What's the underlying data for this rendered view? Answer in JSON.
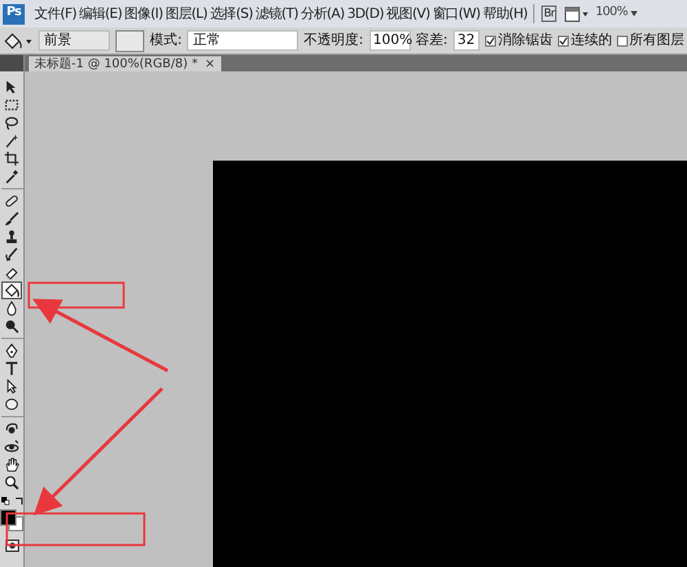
{
  "menu_bar": {
    "app_icon": "Ps",
    "items": [
      "文件(F)",
      "编辑(E)",
      "图像(I)",
      "图层(L)",
      "选择(S)",
      "滤镜(T)",
      "分析(A)",
      "3D(D)",
      "视图(V)",
      "窗口(W)",
      "帮助(H)"
    ],
    "bridge_button": "Br",
    "zoom": "100%"
  },
  "options_bar": {
    "fill_source": "前景",
    "mode_label": "模式:",
    "mode": "正常",
    "opacity_label": "不透明度:",
    "opacity": "100%",
    "tolerance_label": "容差:",
    "tolerance": "32",
    "checkboxes": [
      {
        "label": "消除锯齿",
        "checked": true
      },
      {
        "label": "连续的",
        "checked": true
      },
      {
        "label": "所有图层",
        "checked": false
      }
    ]
  },
  "document_tab": {
    "title": "未标题-1 @ 100%(RGB/8) *",
    "close": "×"
  },
  "tools": [
    {
      "kind": "move",
      "selected": false
    },
    {
      "kind": "marquee",
      "selected": false
    },
    {
      "kind": "lasso",
      "selected": false
    },
    {
      "kind": "wand",
      "selected": false
    },
    {
      "kind": "crop",
      "selected": false
    },
    {
      "kind": "eyedropper",
      "selected": false
    },
    {
      "kind": "separator"
    },
    {
      "kind": "healing",
      "selected": false
    },
    {
      "kind": "brush",
      "selected": false
    },
    {
      "kind": "stamp",
      "selected": false
    },
    {
      "kind": "history",
      "selected": false
    },
    {
      "kind": "eraser",
      "selected": false
    },
    {
      "kind": "bucket",
      "selected": true
    },
    {
      "kind": "blur",
      "selected": false
    },
    {
      "kind": "dodge",
      "selected": false
    },
    {
      "kind": "separator"
    },
    {
      "kind": "pen",
      "selected": false
    },
    {
      "kind": "type",
      "selected": false
    },
    {
      "kind": "path",
      "selected": false
    },
    {
      "kind": "ellipse",
      "selected": false
    },
    {
      "kind": "separator"
    },
    {
      "kind": "rotate3d",
      "selected": false
    },
    {
      "kind": "orbit3d",
      "selected": false
    },
    {
      "kind": "hand",
      "selected": false
    },
    {
      "kind": "zoom",
      "selected": false
    }
  ]
}
